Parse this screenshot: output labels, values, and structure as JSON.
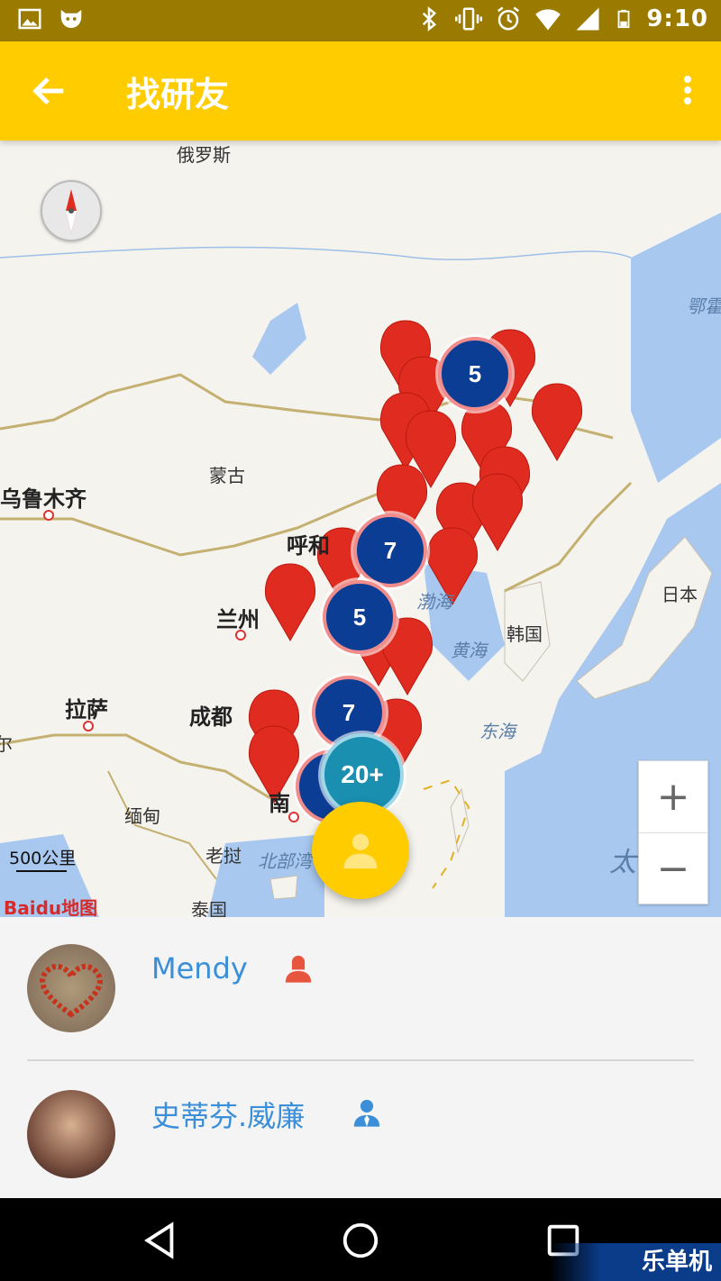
{
  "status_bar": {
    "time": "9:10",
    "icons": [
      "image-icon",
      "app-icon",
      "bluetooth-icon",
      "vibrate-icon",
      "alarm-icon",
      "wifi-icon",
      "signal-icon",
      "battery-icon"
    ]
  },
  "app_bar": {
    "title": "找研友",
    "back_icon": "arrow-back-icon",
    "menu_icon": "more-vert-icon"
  },
  "map": {
    "labels": {
      "russia": "俄罗斯",
      "mongolia": "蒙古",
      "urumqi": "乌鲁木齐",
      "hohhot": "呼和",
      "lanzhou": "兰州",
      "lhasa": "拉萨",
      "chengdu": "成都",
      "myanmar": "缅甸",
      "laos": "老挝",
      "thailand": "泰国",
      "nanning": "南",
      "gulf": "北部湾",
      "bohai": "渤海",
      "yellow_sea": "黄海",
      "east_sea": "东海",
      "korea": "韩国",
      "japan": "日本",
      "okhotsk": "鄂霍",
      "pacific": "太",
      "edge_left": "尔"
    },
    "clusters": [
      "5",
      "7",
      "5",
      "7",
      "20+"
    ],
    "scale": "500公里",
    "brand": "Baidu地图",
    "zoom_in": "+",
    "zoom_out": "−"
  },
  "users": [
    {
      "name": "Mendy",
      "gender": "female"
    },
    {
      "name": "史蒂芬.威廉",
      "gender": "male"
    }
  ],
  "colors": {
    "accent": "#ffcc00",
    "status_bar": "#9a7b00",
    "cluster": "#0c3d94",
    "marker": "#e02b20",
    "female": "#e8553f",
    "male": "#3a8fd8",
    "name": "#3a8fd8"
  },
  "watermark": "乐单机"
}
